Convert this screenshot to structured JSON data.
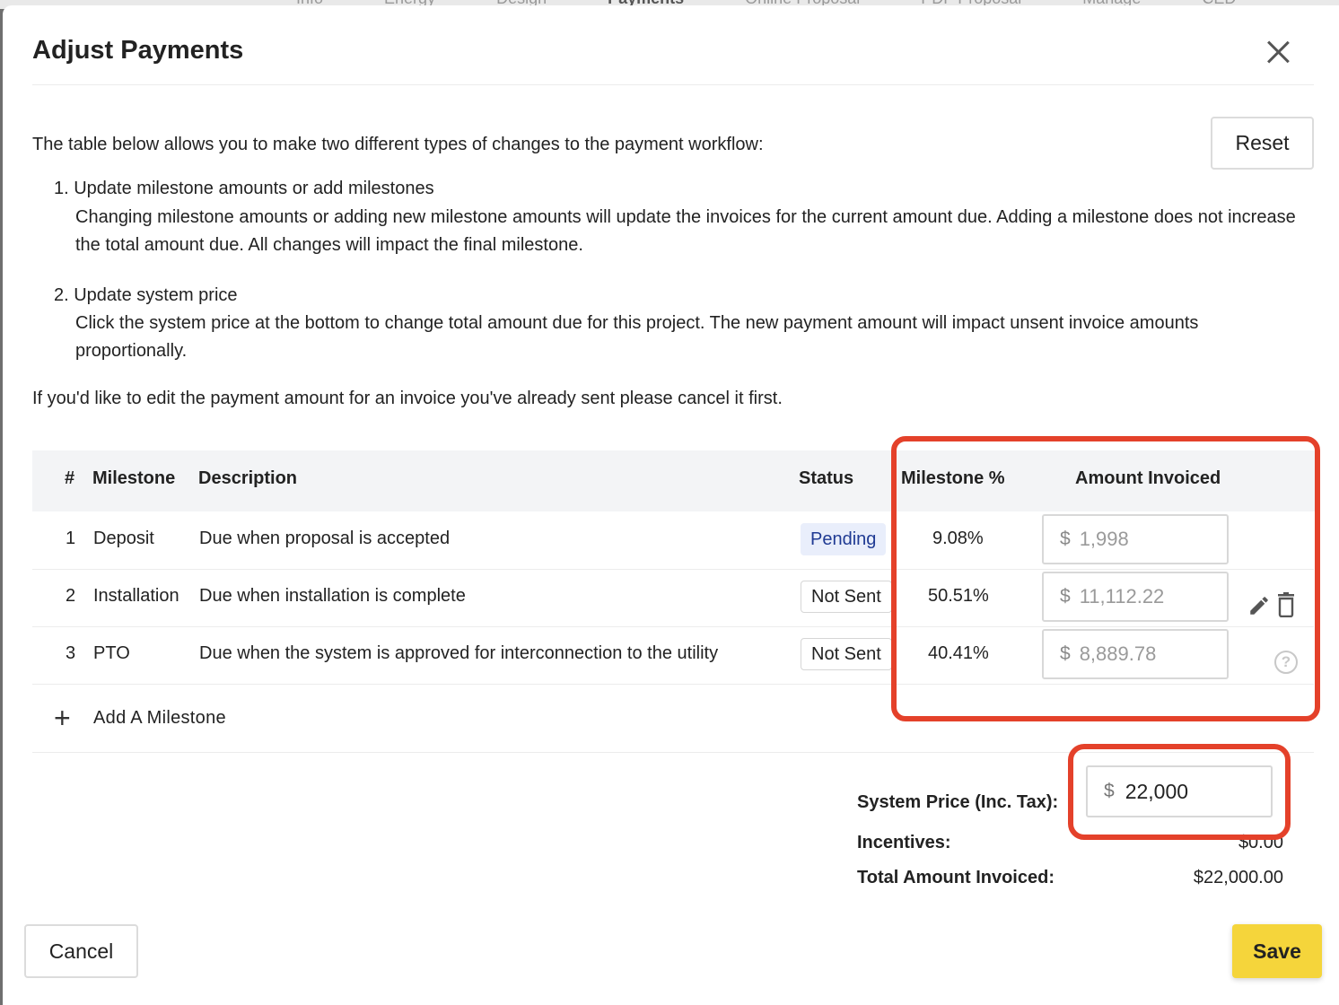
{
  "background_tabs": [
    "Info",
    "Energy",
    "Design",
    "Payments",
    "Online Proposal",
    "PDF Proposal",
    "Manage",
    "CED"
  ],
  "background_active_tab": "Payments",
  "dialog": {
    "title": "Adjust Payments",
    "reset_label": "Reset",
    "intro": "The table below allows you to make two different types of changes to the payment workflow:",
    "item1_title": "1. Update milestone amounts or add milestones",
    "item1_body": "Changing milestone amounts or adding new milestone amounts will update the invoices for the current amount due. Adding a milestone does not increase the total amount due. All changes will impact the final milestone.",
    "item2_title": "2. Update system price",
    "item2_body": "Click the system price at the bottom to change total amount due for this project. The new payment amount will impact unsent invoice amounts proportionally.",
    "note": "If you'd like to edit the payment amount for an invoice you've already sent please cancel it first."
  },
  "table": {
    "headers": {
      "num": "#",
      "milestone": "Milestone",
      "description": "Description",
      "status": "Status",
      "pct": "Milestone %",
      "amount": "Amount Invoiced"
    },
    "rows": [
      {
        "num": "1",
        "milestone": "Deposit",
        "description": "Due when proposal is accepted",
        "status": "Pending",
        "pct": "9.08%",
        "currency": "$",
        "amount": "1,998"
      },
      {
        "num": "2",
        "milestone": "Installation",
        "description": "Due when installation is complete",
        "status": "Not Sent",
        "pct": "50.51%",
        "currency": "$",
        "amount": "11,112.22"
      },
      {
        "num": "3",
        "milestone": "PTO",
        "description": "Due when the system is approved for interconnection to the utility",
        "status": "Not Sent",
        "pct": "40.41%",
        "currency": "$",
        "amount": "8,889.78"
      }
    ],
    "add_label": "Add A Milestone"
  },
  "summary": {
    "system_price_label": "System Price (Inc. Tax):",
    "system_price_currency": "$",
    "system_price_value": "22,000",
    "incentives_label": "Incentives:",
    "incentives_value": "$0.00",
    "total_label": "Total Amount Invoiced:",
    "total_value": "$22,000.00"
  },
  "footer": {
    "cancel_label": "Cancel",
    "save_label": "Save"
  },
  "colors": {
    "save_button": "#f5d53b",
    "highlight": "#e4412a",
    "pending_badge_bg": "#e9eefb",
    "pending_badge_text": "#1f3a93",
    "table_header_bg": "#f3f4f6"
  }
}
